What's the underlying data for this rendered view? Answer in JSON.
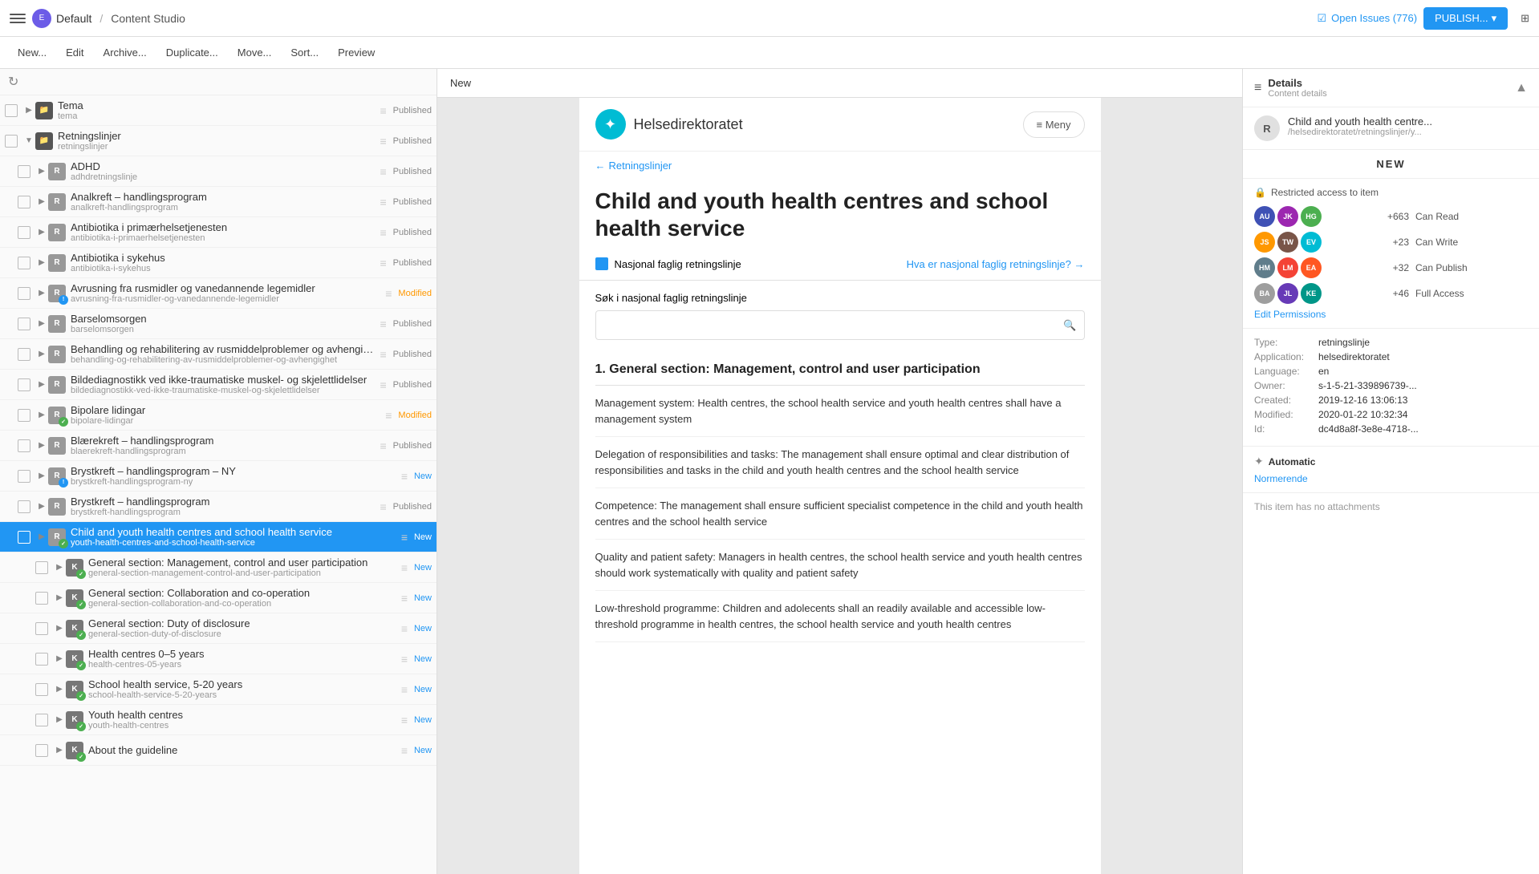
{
  "topbar": {
    "brand_logo": "E",
    "brand_name": "Default",
    "separator": "/",
    "app_name": "Content Studio",
    "open_issues_label": "Open Issues (776)",
    "publish_label": "PUBLISH...",
    "grid_icon": "⊞"
  },
  "toolbar": {
    "new_label": "New...",
    "edit_label": "Edit",
    "archive_label": "Archive...",
    "duplicate_label": "Duplicate...",
    "move_label": "Move...",
    "sort_label": "Sort...",
    "preview_label": "Preview"
  },
  "left_panel": {
    "refresh_icon": "↻",
    "items": [
      {
        "id": "tema",
        "indent": 0,
        "type": "folder",
        "name": "Tema",
        "slug": "tema",
        "status": "Published",
        "status_type": "published",
        "expandable": true,
        "expanded": false,
        "badge": null
      },
      {
        "id": "retningslinjer",
        "indent": 0,
        "type": "folder",
        "name": "Retningslinjer",
        "slug": "retningslinjer",
        "status": "Published",
        "status_type": "published",
        "expandable": true,
        "expanded": true,
        "badge": null
      },
      {
        "id": "adhd",
        "indent": 1,
        "type": "r",
        "name": "ADHD",
        "slug": "adhdretningslinje",
        "status": "Published",
        "status_type": "published",
        "expandable": true,
        "badge": null
      },
      {
        "id": "analkreft",
        "indent": 1,
        "type": "r",
        "name": "Analkreft – handlingsprogram",
        "slug": "analkreft-handlingsprogram",
        "status": "Published",
        "status_type": "published",
        "expandable": true,
        "badge": null
      },
      {
        "id": "antibiotika-prim",
        "indent": 1,
        "type": "r",
        "name": "Antibiotika i primærhelsetjenesten",
        "slug": "antibiotika-i-primaerhelsetjenesten",
        "status": "Published",
        "status_type": "published",
        "expandable": true,
        "badge": null
      },
      {
        "id": "antibiotika-syk",
        "indent": 1,
        "type": "r",
        "name": "Antibiotika i sykehus",
        "slug": "antibiotika-i-sykehus",
        "status": "Published",
        "status_type": "published",
        "expandable": true,
        "badge": null
      },
      {
        "id": "avrusning",
        "indent": 1,
        "type": "r",
        "name": "Avrusning fra rusmidler og vanedannende legemidler",
        "slug": "avrusning-fra-rusmidler-og-vanedannende-legemidler",
        "status": "Modified",
        "status_type": "modified",
        "expandable": true,
        "badge": "!"
      },
      {
        "id": "barselom",
        "indent": 1,
        "type": "r",
        "name": "Barselomsorgen",
        "slug": "barselomsorgen",
        "status": "Published",
        "status_type": "published",
        "expandable": true,
        "badge": null
      },
      {
        "id": "behandling",
        "indent": 1,
        "type": "r",
        "name": "Behandling og rehabilitering av rusmiddelproblemer og avhengig...",
        "slug": "behandling-og-rehabilitering-av-rusmiddelproblemer-og-avhengighet",
        "status": "Published",
        "status_type": "published",
        "expandable": true,
        "badge": null
      },
      {
        "id": "bildediag",
        "indent": 1,
        "type": "r",
        "name": "Bildediagnostikk ved ikke-traumatiske muskel- og skjelettlidelser",
        "slug": "bildediagnostikk-ved-ikke-traumatiske-muskel-og-skjelettlidelser",
        "status": "Published",
        "status_type": "published",
        "expandable": true,
        "badge": null
      },
      {
        "id": "bipolare",
        "indent": 1,
        "type": "r",
        "name": "Bipolare lidingar",
        "slug": "bipolare-lidingar",
        "status": "Modified",
        "status_type": "modified",
        "expandable": true,
        "badge": "✓"
      },
      {
        "id": "blaerekreft",
        "indent": 1,
        "type": "r",
        "name": "Blærekreft – handlingsprogram",
        "slug": "blaerekreft-handlingsprogram",
        "status": "Published",
        "status_type": "published",
        "expandable": true,
        "badge": null
      },
      {
        "id": "brystkreft-ny",
        "indent": 1,
        "type": "r",
        "name": "Brystkreft – handlingsprogram – NY",
        "slug": "brystkreft-handlingsprogram-ny",
        "status": "New",
        "status_type": "new",
        "expandable": true,
        "badge": "!"
      },
      {
        "id": "brystkreft",
        "indent": 1,
        "type": "r",
        "name": "Brystkreft – handlingsprogram",
        "slug": "brystkreft-handlingsprogram",
        "status": "Published",
        "status_type": "published",
        "expandable": true,
        "badge": null
      },
      {
        "id": "child-youth",
        "indent": 1,
        "type": "r",
        "name": "Child and youth health centres and school health service",
        "slug": "youth-health-centres-and-school-health-service",
        "status": "New",
        "status_type": "new",
        "expandable": true,
        "badge": "✓",
        "selected": true
      },
      {
        "id": "general-mgmt",
        "indent": 2,
        "type": "k",
        "name": "General section: Management, control and user participation",
        "slug": "general-section-management-control-and-user-participation",
        "status": "New",
        "status_type": "new",
        "expandable": true,
        "badge": "✓"
      },
      {
        "id": "general-collab",
        "indent": 2,
        "type": "k",
        "name": "General section: Collaboration and co-operation",
        "slug": "general-section-collaboration-and-co-operation",
        "status": "New",
        "status_type": "new",
        "expandable": true,
        "badge": "✓"
      },
      {
        "id": "general-duty",
        "indent": 2,
        "type": "k",
        "name": "General section: Duty of disclosure",
        "slug": "general-section-duty-of-disclosure",
        "status": "New",
        "status_type": "new",
        "expandable": true,
        "badge": "✓"
      },
      {
        "id": "health-0-5",
        "indent": 2,
        "type": "k",
        "name": "Health centres 0–5 years",
        "slug": "health-centres-05-years",
        "status": "New",
        "status_type": "new",
        "expandable": true,
        "badge": "✓"
      },
      {
        "id": "school-5-20",
        "indent": 2,
        "type": "k",
        "name": "School health service, 5-20 years",
        "slug": "school-health-service-5-20-years",
        "status": "New",
        "status_type": "new",
        "expandable": true,
        "badge": "✓"
      },
      {
        "id": "youth-health",
        "indent": 2,
        "type": "k",
        "name": "Youth health centres",
        "slug": "youth-health-centres",
        "status": "New",
        "status_type": "new",
        "expandable": true,
        "badge": "✓"
      },
      {
        "id": "about-guideline",
        "indent": 2,
        "type": "k",
        "name": "About the guideline",
        "slug": "",
        "status": "New",
        "status_type": "new",
        "expandable": true,
        "badge": "✓"
      }
    ]
  },
  "center_panel": {
    "tab_label": "New",
    "preview": {
      "logo_text": "Helsedirektoratet",
      "menu_label": "≡ Meny",
      "breadcrumb_icon": "←",
      "breadcrumb_text": "Retningslinjer",
      "title": "Child and youth health centres and school health service",
      "meta_doc_type": "Nasjonal faglig retningslinje",
      "meta_link": "Hva er nasjonal faglig retningslinje? →",
      "search_placeholder": "Søk i nasjonal faglig retningslinje",
      "section_title": "1. General section: Management, control and user participation",
      "section_items": [
        "Management system: Health centres, the school health service and youth health centres shall have a management system",
        "Delegation of responsibilities and tasks: The management shall ensure optimal and clear distribution of responsibilities and tasks in the child and youth health centres and the school health service",
        "Competence: The management shall ensure sufficient specialist competence in the child and youth health centres and the school health service",
        "Quality and patient safety: Managers in health centres, the school health service and youth health centres should work systematically with quality and patient safety",
        "Low-threshold programme: Children and adolecents shall an readily available and accessible low-threshold programme in health centres, the school health service and youth health centres"
      ]
    }
  },
  "right_panel": {
    "header": {
      "title": "Details",
      "subtitle": "Content details",
      "collapse_icon": "▲"
    },
    "content_preview": {
      "icon": "R",
      "title": "Child and youth health centre...",
      "path": "/helsedirektoratet/retningslinjer/y..."
    },
    "new_badge": "NEW",
    "access": {
      "lock_label": "Restricted access to item",
      "rows": [
        {
          "avatars": [
            "AU",
            "JK",
            "HG"
          ],
          "avatar_colors": [
            "au",
            "jk",
            "hg"
          ],
          "count": "+663",
          "label": "Can Read"
        },
        {
          "avatars": [
            "JS",
            "TW",
            "EV"
          ],
          "avatar_colors": [
            "js",
            "tw",
            "ev"
          ],
          "count": "+23",
          "label": "Can Write"
        },
        {
          "avatars": [
            "HM",
            "LM",
            "EA"
          ],
          "avatar_colors": [
            "hm",
            "lm",
            "ea"
          ],
          "count": "+32",
          "label": "Can Publish"
        },
        {
          "avatars": [
            "BA",
            "JL",
            "KE"
          ],
          "avatar_colors": [
            "ba",
            "jl",
            "ke"
          ],
          "count": "+46",
          "label": "Full Access"
        }
      ],
      "edit_permissions_label": "Edit Permissions"
    },
    "metadata": {
      "rows": [
        {
          "key": "Type:",
          "value": "retningslinje",
          "link": false
        },
        {
          "key": "Application:",
          "value": "helsedirektoratet",
          "link": false
        },
        {
          "key": "Language:",
          "value": "en",
          "link": false
        },
        {
          "key": "Owner:",
          "value": "s-1-5-21-339896739-...",
          "link": false
        },
        {
          "key": "Created:",
          "value": "2019-12-16 13:06:13",
          "link": false
        },
        {
          "key": "Modified:",
          "value": "2020-01-22 10:32:34",
          "link": false
        },
        {
          "key": "Id:",
          "value": "dc4d8a8f-3e8e-4718-...",
          "link": false
        }
      ]
    },
    "auto": {
      "icon": "✦",
      "title": "Automatic",
      "value": "Normerende"
    },
    "attachments": {
      "label": "This item has no attachments"
    }
  }
}
